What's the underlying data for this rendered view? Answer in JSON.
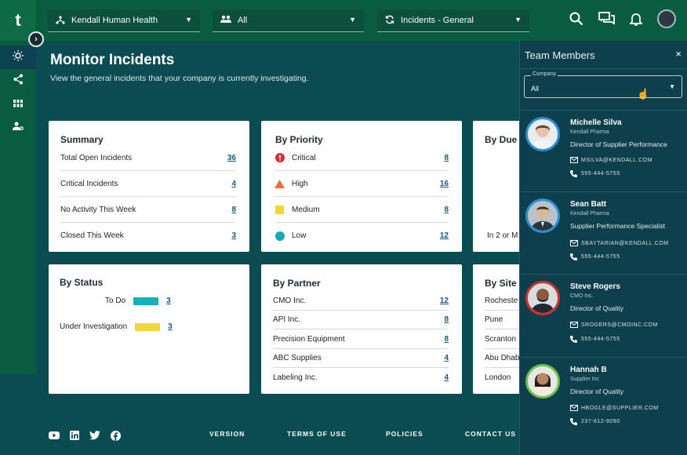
{
  "brand": {
    "logo_letter": "t"
  },
  "topbar": {
    "company_select": "Kendall Human Health",
    "team_select": "All",
    "view_select": "Incidents - General"
  },
  "header": {
    "title": "Monitor Incidents",
    "subtitle": "View the general incidents that your company is currently investigating."
  },
  "summary": {
    "title": "Summary",
    "rows": [
      {
        "label": "Total Open Incidents",
        "value": "36"
      },
      {
        "label": "Critical Incidents",
        "value": "4"
      },
      {
        "label": "No Activity This Week",
        "value": "8"
      },
      {
        "label": "Closed This Week",
        "value": "3"
      }
    ]
  },
  "priority": {
    "title": "By Priority",
    "rows": [
      {
        "label": "Critical",
        "value": "8",
        "icon": "critical-icon",
        "color": "#d32f2f"
      },
      {
        "label": "High",
        "value": "16",
        "icon": "high-icon",
        "color": "#f06a35"
      },
      {
        "label": "Medium",
        "value": "8",
        "icon": "medium-icon",
        "color": "#f5d63a"
      },
      {
        "label": "Low",
        "value": "12",
        "icon": "low-icon",
        "color": "#14a9b8"
      }
    ]
  },
  "due": {
    "title": "By Due",
    "partial_row": "In 2 or M"
  },
  "status": {
    "title": "By Status",
    "rows": [
      {
        "label": "To Do",
        "value": "3",
        "color": "#13b1bb"
      },
      {
        "label": "Under Investigation",
        "value": "3",
        "color": "#f5d63a"
      }
    ]
  },
  "partner": {
    "title": "By Partner",
    "rows": [
      {
        "label": "CMO Inc.",
        "value": "12"
      },
      {
        "label": "API Inc.",
        "value": "8"
      },
      {
        "label": "Precision Equipment",
        "value": "8"
      },
      {
        "label": "ABC Supplies",
        "value": "4"
      },
      {
        "label": "Labeling Inc.",
        "value": "4"
      }
    ]
  },
  "site": {
    "title": "By Site",
    "rows": [
      {
        "label": "Rocheste"
      },
      {
        "label": "Pune"
      },
      {
        "label": "Scranton"
      },
      {
        "label": "Abu Dhab"
      },
      {
        "label": "London"
      }
    ]
  },
  "footer": {
    "links": [
      "VERSION",
      "TERMS OF USE",
      "POLICIES",
      "CONTACT US"
    ]
  },
  "team_panel": {
    "title": "Team Members",
    "close": "×",
    "company_caption": "Company",
    "company_value": "All",
    "members": [
      {
        "name": "Michelle Silva",
        "company": "Kendall Pharma",
        "role": "Director of Supplier Performance",
        "email": "MSILVA@KENDALL.COM",
        "phone": "555-444-5755",
        "ring": "#2a90d6",
        "skin": "#e8c4ad"
      },
      {
        "name": "Sean Batt",
        "company": "Kendall Pharma",
        "role": "Supplier Performance Specialist",
        "email": "SBAYTARIAN@KENDALL.COM",
        "phone": "555-444-5755",
        "ring": "#2a90d6",
        "skin": "#d8b79b"
      },
      {
        "name": "Steve Rogers",
        "company": "CMO Inc.",
        "role": "Director of Quality",
        "email": "SROGERS@CMOINC.COM",
        "phone": "555-444-5755",
        "ring": "#d32f2f",
        "skin": "#8a5a3e"
      },
      {
        "name": "Hannah B",
        "company": "Supplier Inc",
        "role": "Director of Quality",
        "email": "HBOGLE@SUPPLIER.COM",
        "phone": "237-612-9090",
        "ring": "#6cc04a",
        "skin": "#b98763"
      }
    ]
  }
}
